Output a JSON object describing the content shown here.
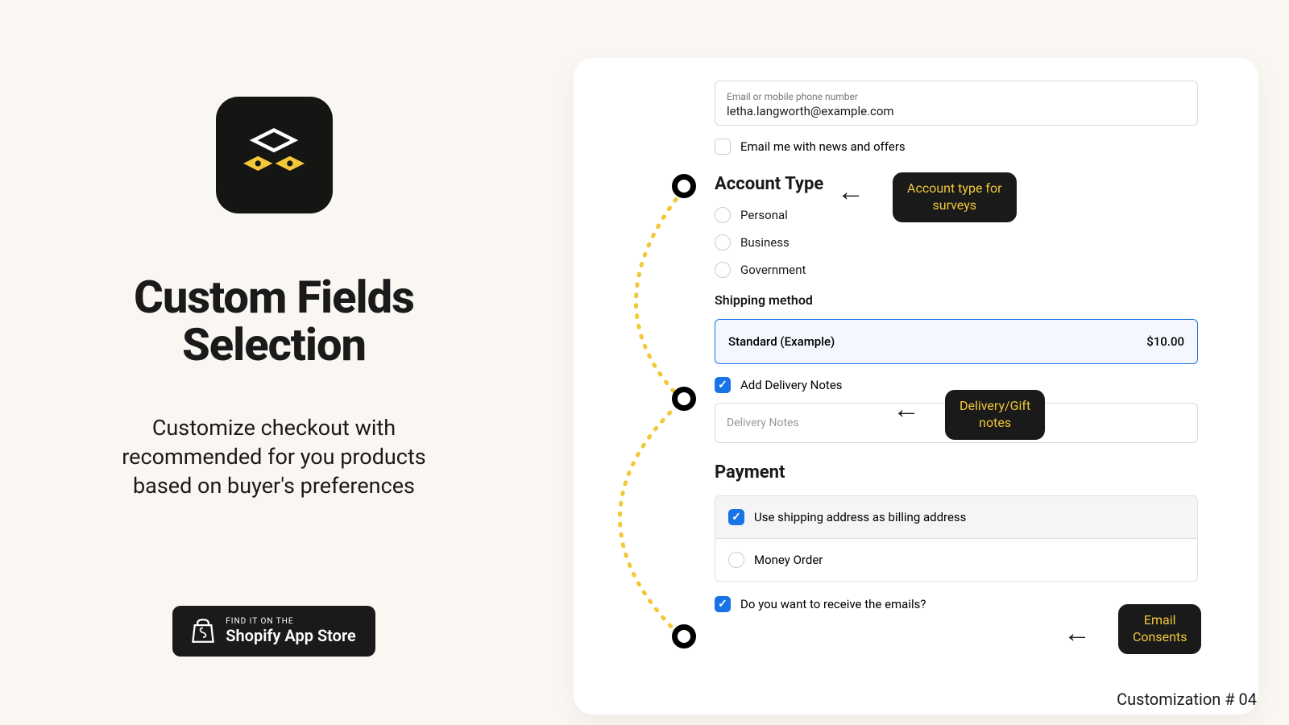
{
  "left": {
    "title_l1": "Custom Fields",
    "title_l2": "Selection",
    "subtitle_l1": "Customize checkout with",
    "subtitle_l2": "recommended for you products",
    "subtitle_l3": "based on buyer's preferences",
    "store_small": "FIND IT ON THE",
    "store_big": "Shopify App Store"
  },
  "form": {
    "email_label": "Email or mobile phone number",
    "email_value": "letha.langworth@example.com",
    "news_label": "Email me with news and offers",
    "account_title": "Account Type",
    "account_opts": [
      "Personal",
      "Business",
      "Government"
    ],
    "ship_title": "Shipping method",
    "ship_name": "Standard (Example)",
    "ship_price": "$10.00",
    "delivery_chk": "Add Delivery Notes",
    "delivery_ph": "Delivery Notes",
    "pay_title": "Payment",
    "pay_row1": "Use shipping address as billing address",
    "pay_row2": "Money Order",
    "consent_label": "Do you want to receive the emails?"
  },
  "callouts": {
    "c1": "Account type for\nsurveys",
    "c2": "Delivery/Gift\nnotes",
    "c3": "Email\nConsents"
  },
  "footer": "Customization # 04"
}
